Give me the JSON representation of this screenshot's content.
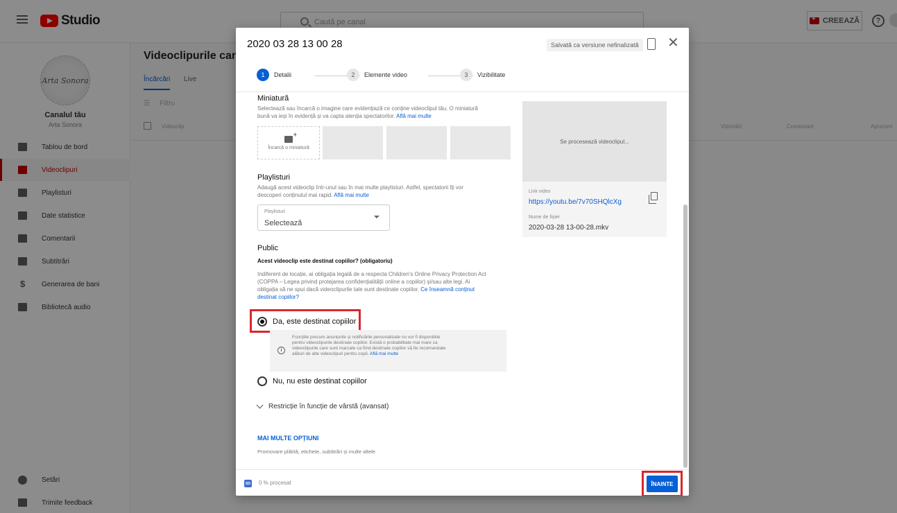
{
  "topbar": {
    "logo_text": "Studio",
    "search_placeholder": "Caută pe canal",
    "create_label": "CREEAZĂ",
    "help_glyph": "?"
  },
  "sidebar": {
    "channel_title": "Canalul tău",
    "channel_name": "Arta Sonora",
    "avatar_text": "Arta Sonora",
    "items": [
      {
        "label": "Tablou de bord",
        "icon": "dashboard-icon"
      },
      {
        "label": "Videoclipuri",
        "icon": "videos-icon",
        "active": true
      },
      {
        "label": "Playlisturi",
        "icon": "playlists-icon"
      },
      {
        "label": "Date statistice",
        "icon": "analytics-icon"
      },
      {
        "label": "Comentarii",
        "icon": "comments-icon"
      },
      {
        "label": "Subtitrări",
        "icon": "subtitles-icon"
      },
      {
        "label": "Generarea de bani",
        "icon": "monetization-icon"
      },
      {
        "label": "Bibliotecă audio",
        "icon": "audio-library-icon"
      }
    ],
    "bottom_items": [
      {
        "label": "Setări",
        "icon": "settings-icon"
      },
      {
        "label": "Trimite feedback",
        "icon": "feedback-icon"
      }
    ]
  },
  "content": {
    "title": "Videoclipurile canalului",
    "tabs": [
      "Încărcări",
      "Live"
    ],
    "filter_label": "Filtru",
    "columns": [
      "Videoclip",
      "Vizionări",
      "Comentarii",
      "Aprecieri"
    ]
  },
  "modal": {
    "title": "2020 03 28 13 00 28",
    "draft_badge": "Salvată ca versiune nefinalizată",
    "close_glyph": "✕",
    "steps": [
      {
        "number": "1",
        "label": "Detalii"
      },
      {
        "number": "2",
        "label": "Elemente video"
      },
      {
        "number": "3",
        "label": "Vizibilitate"
      }
    ],
    "thumbnail": {
      "heading": "Miniatură",
      "desc_line1": "Selectează sau încarcă o imagine care evidențiază ce conține videoclipul tău. O miniatură",
      "desc_line2_prefix": "bună va ieși în evidență și va capta atenția spectatorilor. ",
      "learn_more": "Află mai multe",
      "upload_label": "Încarcă o miniatură"
    },
    "playlists": {
      "heading": "Playlisturi",
      "desc_line1": "Adaugă acest videoclip într-unul sau în mai multe playlisturi. Astfel, spectatorii îți vor",
      "desc_line2_prefix": "descoperi conținutul mai rapid. ",
      "learn_more": "Află mai multe",
      "select_label": "Playlisturi",
      "select_value": "Selectează"
    },
    "audience": {
      "heading": "Public",
      "question": "Acest videoclip este destinat copiilor? (obligatoriu)",
      "desc_line1": "Indiferent de locație, ai obligația legală de a respecta Children's Online Privacy Protection Act",
      "desc_line2": "(COPPA – Legea privind protejarea confidențialității online a copiilor) și/sau alte legi. Ai",
      "desc_line3_prefix": "obligația să ne spui dacă videoclipurile tale sunt destinate copiilor. ",
      "desc_link": "Ce înseamnă conținut",
      "desc_link2": "destinat copiilor?",
      "option_yes": "Da, este destinat copiilor",
      "option_no": "Nu, nu este destinat copiilor",
      "info_line1": "Funcțiile precum anunțurile și notificările personalizate nu vor fi disponibile",
      "info_line2": "pentru videoclipurile destinate copiilor. Există o probabilitate mai mare ca",
      "info_line3": "videoclipurile care sunt marcate ca fiind destinate copiilor să fie recomandate",
      "info_line4_prefix": "alături de alte videoclipuri pentru copii. ",
      "info_learn_more": "Află mai multe",
      "age_restriction": "Restricție în funcție de vârstă (avansat)"
    },
    "more": {
      "label": "MAI MULTE OPȚIUNI",
      "desc": "Promovare plătită, etichete, subtitrări și multe altele"
    },
    "side": {
      "processing": "Se procesează videoclipul...",
      "link_label": "Link video",
      "link_value": "https://youtu.be/7v70SHQlcXg",
      "file_label": "Nume de fișier",
      "file_value": "2020-03-28 13-00-28.mkv"
    },
    "footer": {
      "badge": "SD",
      "progress": "0 % procesat",
      "next_label": "ÎNAINTE"
    }
  },
  "colors": {
    "accent": "#065fd4",
    "brand": "#ff0000",
    "highlight": "#d9262c"
  }
}
